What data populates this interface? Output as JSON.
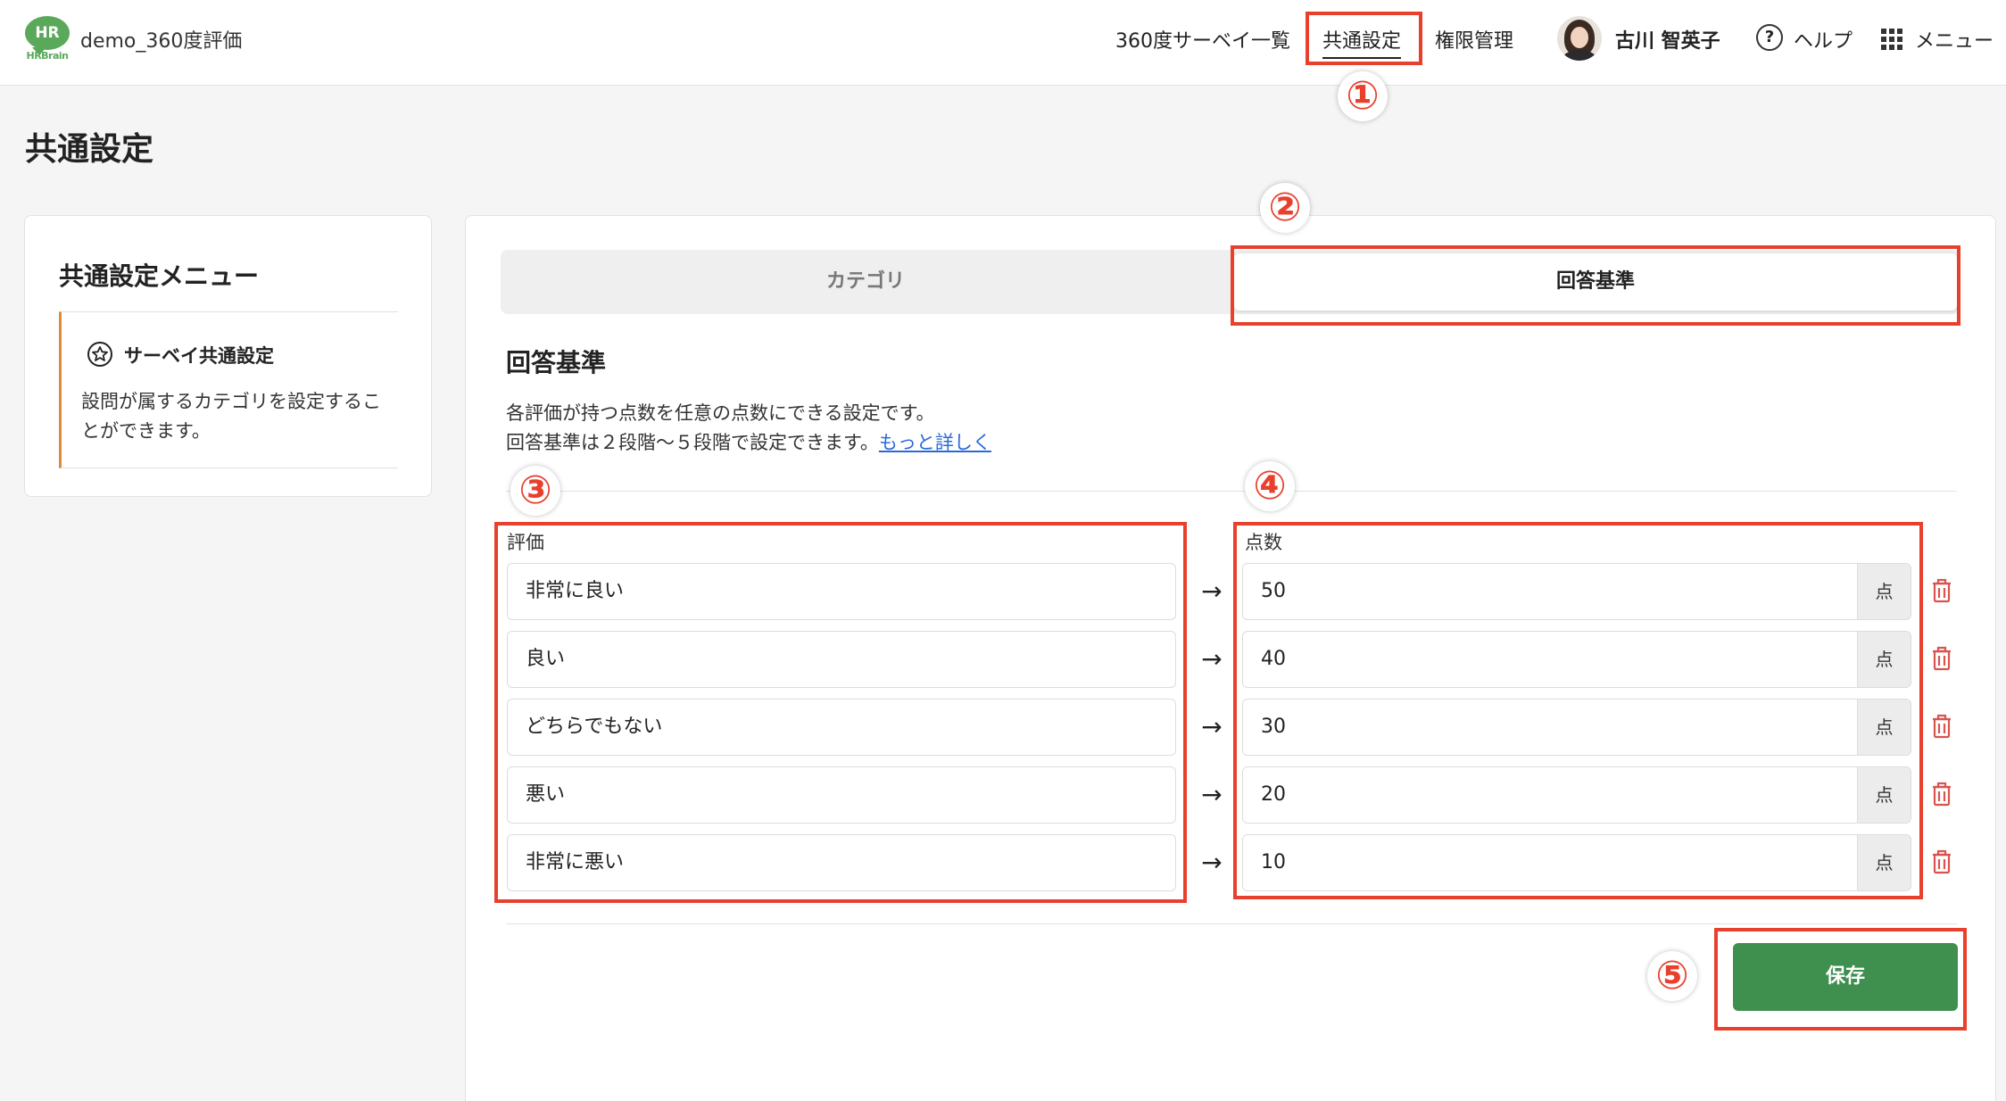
{
  "header": {
    "logo_mark": "HR",
    "logo_text": "HRBrain",
    "org_name": "demo_360度評価",
    "nav": {
      "survey_list": "360度サーベイ一覧",
      "common_settings": "共通設定",
      "permissions": "権限管理"
    },
    "user_name": "古川 智英子",
    "help_label": "ヘルプ",
    "menu_label": "メニュー"
  },
  "page_title": "共通設定",
  "sidebar": {
    "title": "共通設定メニュー",
    "item_label": "サーベイ共通設定",
    "item_desc": "設問が属するカテゴリを設定することができます。"
  },
  "tabs": {
    "category": "カテゴリ",
    "answer_criteria": "回答基準"
  },
  "section": {
    "title": "回答基準",
    "desc_line1": "各評価が持つ点数を任意の点数にできる設定です。",
    "desc_line2": "回答基準は２段階〜５段階で設定できます。",
    "more_link": "もっと詳しく"
  },
  "columns": {
    "evaluation": "評価",
    "score": "点数"
  },
  "rows": [
    {
      "evaluation": "非常に良い",
      "score": "50",
      "unit": "点"
    },
    {
      "evaluation": "良い",
      "score": "40",
      "unit": "点"
    },
    {
      "evaluation": "どちらでもない",
      "score": "30",
      "unit": "点"
    },
    {
      "evaluation": "悪い",
      "score": "20",
      "unit": "点"
    },
    {
      "evaluation": "非常に悪い",
      "score": "10",
      "unit": "点"
    }
  ],
  "arrow_glyph": "→",
  "save_label": "保存",
  "annotations": [
    "①",
    "②",
    "③",
    "④",
    "⑤"
  ],
  "colors": {
    "brand_green": "#5aa85a",
    "save_green": "#3f8f4f",
    "annotation_red": "#e8402c",
    "sidebar_accent": "#e08a3c",
    "trash_red": "#d9534f",
    "link_blue": "#2a6ad8"
  }
}
